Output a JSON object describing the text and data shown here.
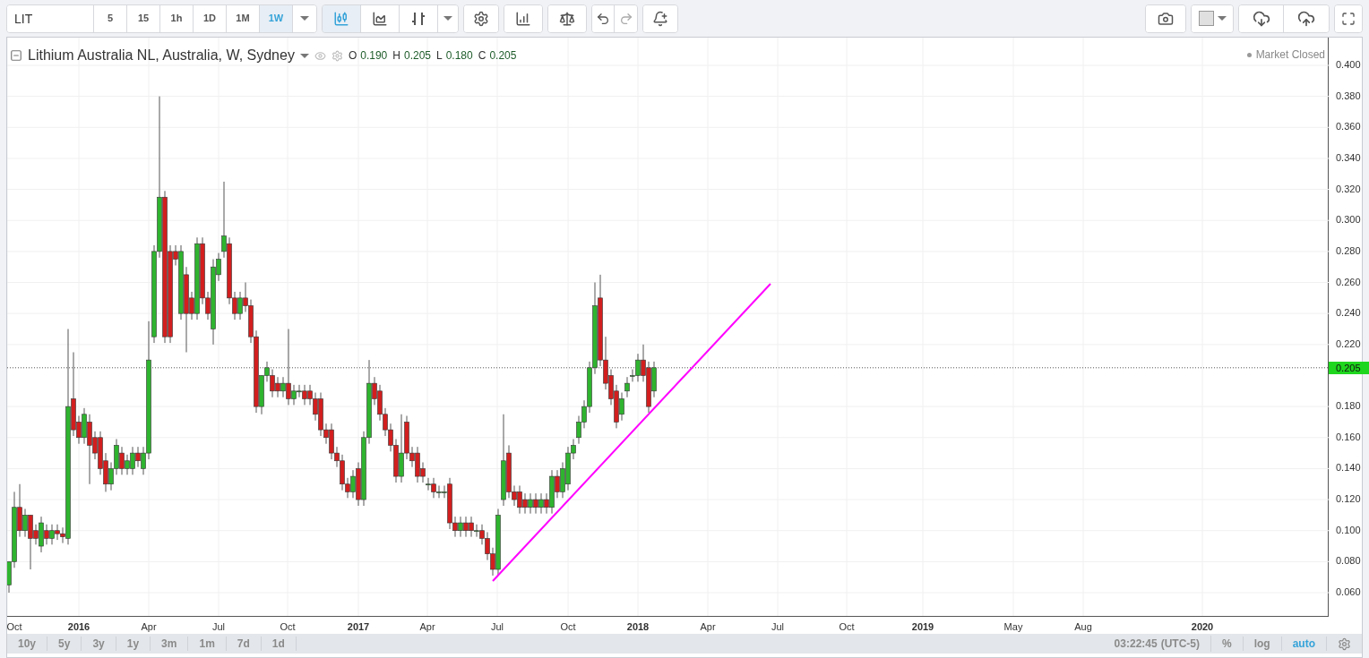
{
  "toolbar": {
    "symbol": "LIT",
    "intervals": [
      {
        "label": "5",
        "selected": false
      },
      {
        "label": "15",
        "selected": false
      },
      {
        "label": "1h",
        "selected": false
      },
      {
        "label": "1D",
        "selected": false
      },
      {
        "label": "1M",
        "selected": false
      },
      {
        "label": "1W",
        "selected": true
      }
    ],
    "chart_styles": [
      {
        "kind": "candles",
        "selected": true
      },
      {
        "kind": "area",
        "selected": false
      },
      {
        "kind": "bars",
        "selected": false
      }
    ]
  },
  "legend": {
    "title": "Lithium Australia NL, Australia, W, Sydney",
    "ohlc": [
      {
        "key": "O",
        "value": "0.190"
      },
      {
        "key": "H",
        "value": "0.205"
      },
      {
        "key": "L",
        "value": "0.180"
      },
      {
        "key": "C",
        "value": "0.205"
      }
    ]
  },
  "market_status": "Market Closed",
  "price_axis": {
    "ticks": [
      "0.400",
      "0.380",
      "0.360",
      "0.340",
      "0.320",
      "0.300",
      "0.280",
      "0.260",
      "0.240",
      "0.220",
      "0.180",
      "0.160",
      "0.140",
      "0.120",
      "0.100",
      "0.080",
      "0.060"
    ],
    "last_price": "0.205"
  },
  "time_axis": [
    {
      "label": "Oct",
      "kind": "month"
    },
    {
      "label": "2016",
      "kind": "year"
    },
    {
      "label": "Apr",
      "kind": "month"
    },
    {
      "label": "Jul",
      "kind": "month"
    },
    {
      "label": "Oct",
      "kind": "month"
    },
    {
      "label": "2017",
      "kind": "year"
    },
    {
      "label": "Apr",
      "kind": "month"
    },
    {
      "label": "Jul",
      "kind": "month"
    },
    {
      "label": "Oct",
      "kind": "month"
    },
    {
      "label": "2018",
      "kind": "year"
    },
    {
      "label": "Apr",
      "kind": "month"
    },
    {
      "label": "Jul",
      "kind": "month"
    },
    {
      "label": "Oct",
      "kind": "month"
    },
    {
      "label": "2019",
      "kind": "year"
    },
    {
      "label": "May",
      "kind": "month"
    },
    {
      "label": "Aug",
      "kind": "month"
    },
    {
      "label": "2020",
      "kind": "year"
    }
  ],
  "ranges": [
    "10y",
    "5y",
    "3y",
    "1y",
    "3m",
    "1m",
    "7d",
    "1d"
  ],
  "status_bar": {
    "time": "03:22:45",
    "timezone": "(UTC-5)",
    "toggles": [
      {
        "label": "%",
        "on": false
      },
      {
        "label": "log",
        "on": false
      },
      {
        "label": "auto",
        "on": true
      }
    ]
  }
}
